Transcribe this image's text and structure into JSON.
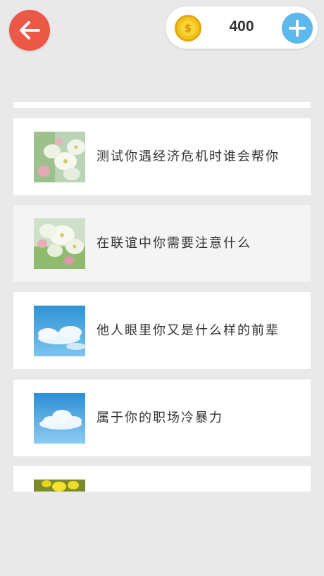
{
  "header": {
    "back_icon": "arrow-left-icon",
    "coin_icon": "dollar-coin-icon",
    "coin_symbol": "$",
    "coin_count": "400",
    "add_icon": "plus-icon",
    "colors": {
      "back_button": "#ec5848",
      "coin": "#f3c21c",
      "add_button": "#5db8ee",
      "background": "#e9e9e9"
    }
  },
  "list": {
    "items": [
      {
        "title": "测试你遇经济危机时谁会帮你",
        "image": "white-blossom-image"
      },
      {
        "title": "在联谊中你需要注意什么",
        "image": "white-blossom-image"
      },
      {
        "title": "他人眼里你又是什么样的前辈",
        "image": "blue-sky-clouds-image"
      },
      {
        "title": "属于你的职场冷暴力",
        "image": "blue-sky-clouds-image"
      },
      {
        "title": "",
        "image": "yellow-flower-image"
      }
    ]
  }
}
